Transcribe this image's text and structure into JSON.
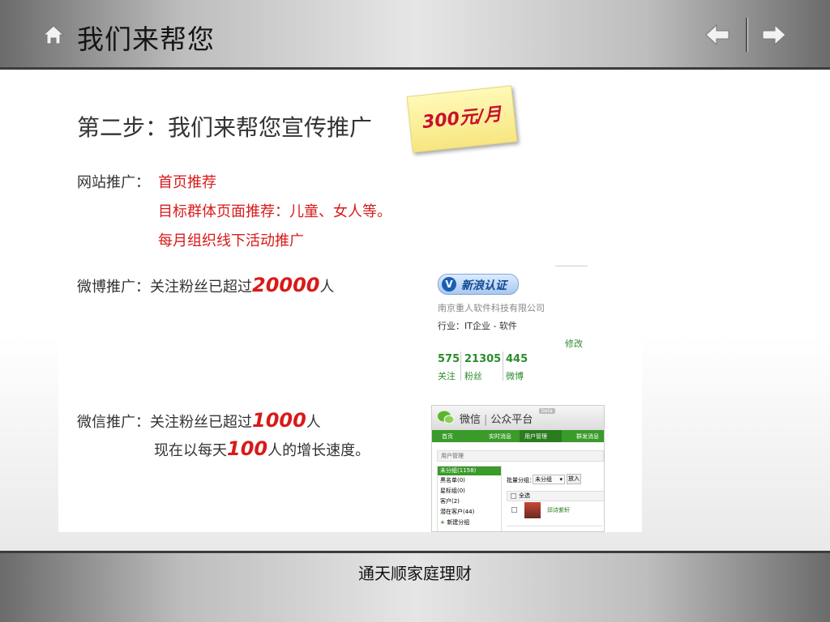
{
  "header": {
    "title": "我们来帮您",
    "icons": {
      "home": "home-icon",
      "prev": "arrow-left-icon",
      "next": "arrow-right-icon"
    }
  },
  "main": {
    "step_title": "第二步：我们来帮您宣传推广",
    "price_note": "300元/月",
    "website": {
      "label": "网站推广：",
      "items": [
        "首页推荐",
        "目标群体页面推荐：儿童、女人等。",
        "每月组织线下活动推广"
      ]
    },
    "weibo": {
      "prefix": "微博推广：关注粉丝已超过",
      "number": "20000",
      "suffix": "人"
    },
    "wechat": {
      "prefix": "微信推广：关注粉丝已超过",
      "number": "1000",
      "suffix": "人",
      "line2_prefix": "现在以每天",
      "line2_number": "100",
      "line2_suffix": "人的增长速度。"
    }
  },
  "weibo_card": {
    "badge": "新浪认证",
    "company": "南京重人软件科技有限公司",
    "industry": "行业：IT企业 - 软件",
    "edit": "修改",
    "stats": [
      {
        "value": "575",
        "label": "关注"
      },
      {
        "value": "21305",
        "label": "粉丝"
      },
      {
        "value": "445",
        "label": "微博"
      }
    ]
  },
  "wechat_card": {
    "brand": "微信",
    "platform": "公众平台",
    "beta": "beta",
    "nav": [
      "首页",
      "实时消息",
      "用户管理",
      "群发消息"
    ],
    "section": "用户管理",
    "groups": [
      "未分组(1158)",
      "黑名单(0)",
      "星标组(0)",
      "客户(2)",
      "潜在客户(44)",
      "新建分组"
    ],
    "batch_label": "批量分组：",
    "batch_select": "未分组",
    "join_button": "放入",
    "select_all": "全选",
    "user_name": "邱诗紫轩"
  },
  "footer": {
    "text": "通天顺家庭理财"
  },
  "colors": {
    "accent_red": "#d91a1a",
    "weibo_green": "#2e8b2e",
    "wechat_green": "#3a9a2a"
  }
}
